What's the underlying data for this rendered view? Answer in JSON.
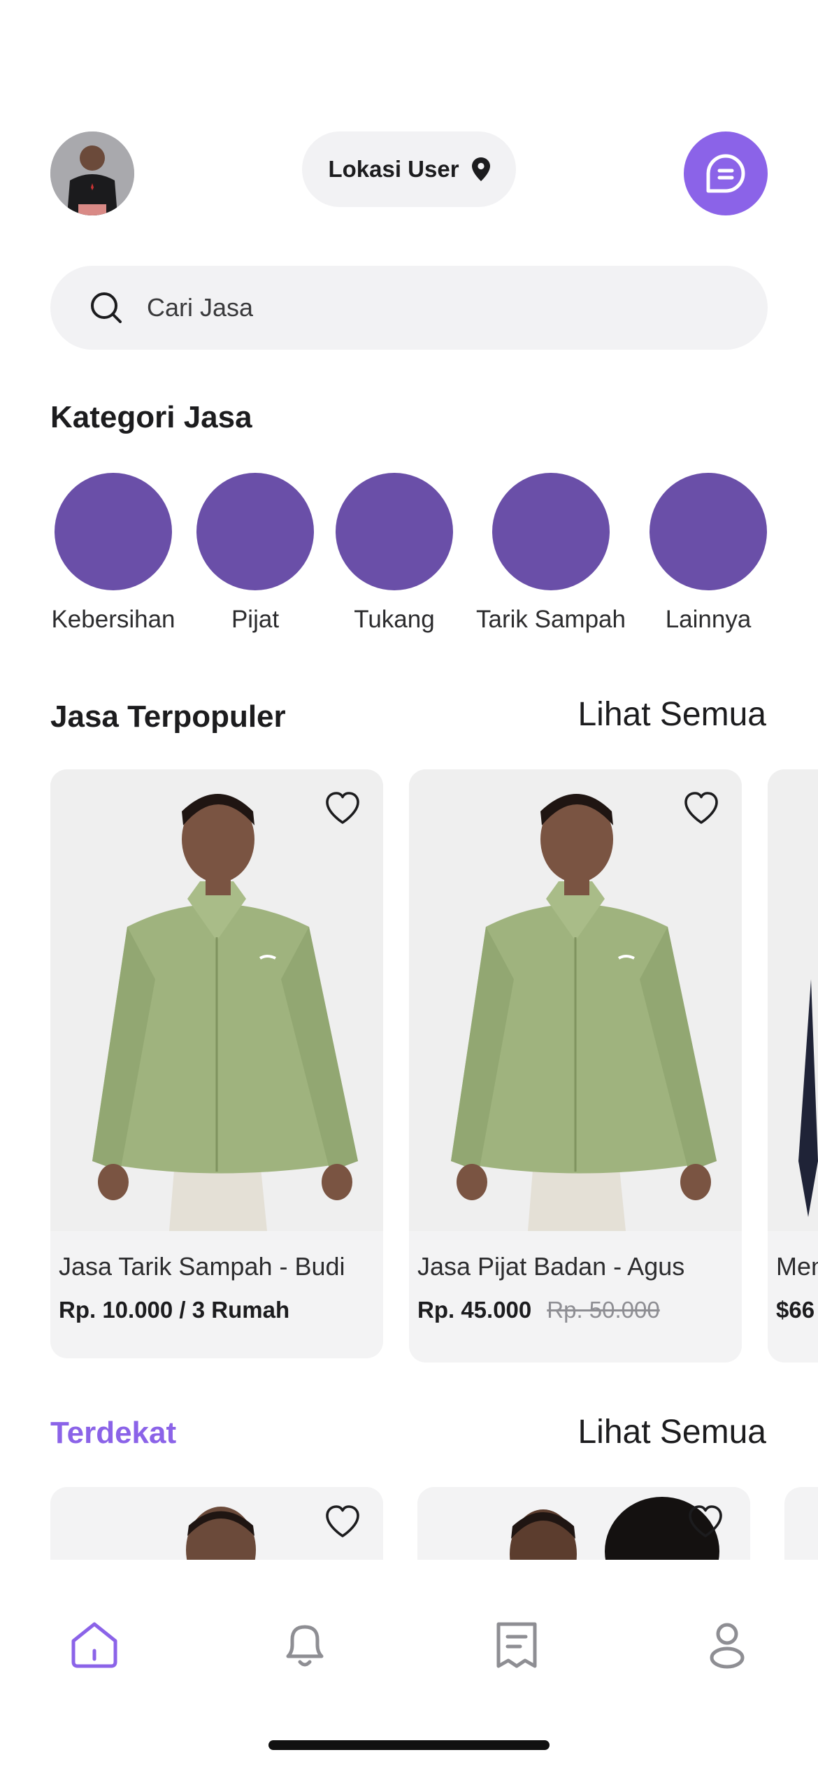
{
  "header": {
    "location_label": "Lokasi User",
    "avatar_alt": "avatar",
    "accent_color": "#8b63e8"
  },
  "search": {
    "placeholder": "Cari Jasa"
  },
  "categories": {
    "title": "Kategori Jasa",
    "color": "#6a4fa8",
    "items": [
      {
        "label": "Kebersihan"
      },
      {
        "label": "Pijat"
      },
      {
        "label": "Tukang"
      },
      {
        "label": "Tarik Sampah"
      },
      {
        "label": "Lainnya"
      }
    ]
  },
  "popular": {
    "title": "Jasa Terpopuler",
    "see_all": "Lihat Semua",
    "items": [
      {
        "name": "Jasa Tarik Sampah - Budi",
        "price": "Rp. 10.000 / 3 Rumah",
        "old_price": ""
      },
      {
        "name": "Jasa Pijat Badan - Agus",
        "price": "Rp. 45.000",
        "old_price": "Rp. 50.000"
      },
      {
        "name": "Men",
        "price": "$66",
        "old_price": ""
      }
    ]
  },
  "nearby": {
    "title": "Terdekat",
    "see_all": "Lihat Semua",
    "title_color": "#8b63e8"
  },
  "nav": {
    "items": [
      {
        "icon": "home-icon",
        "active": true
      },
      {
        "icon": "bell-icon",
        "active": false
      },
      {
        "icon": "receipt-icon",
        "active": false
      },
      {
        "icon": "profile-icon",
        "active": false
      }
    ]
  }
}
